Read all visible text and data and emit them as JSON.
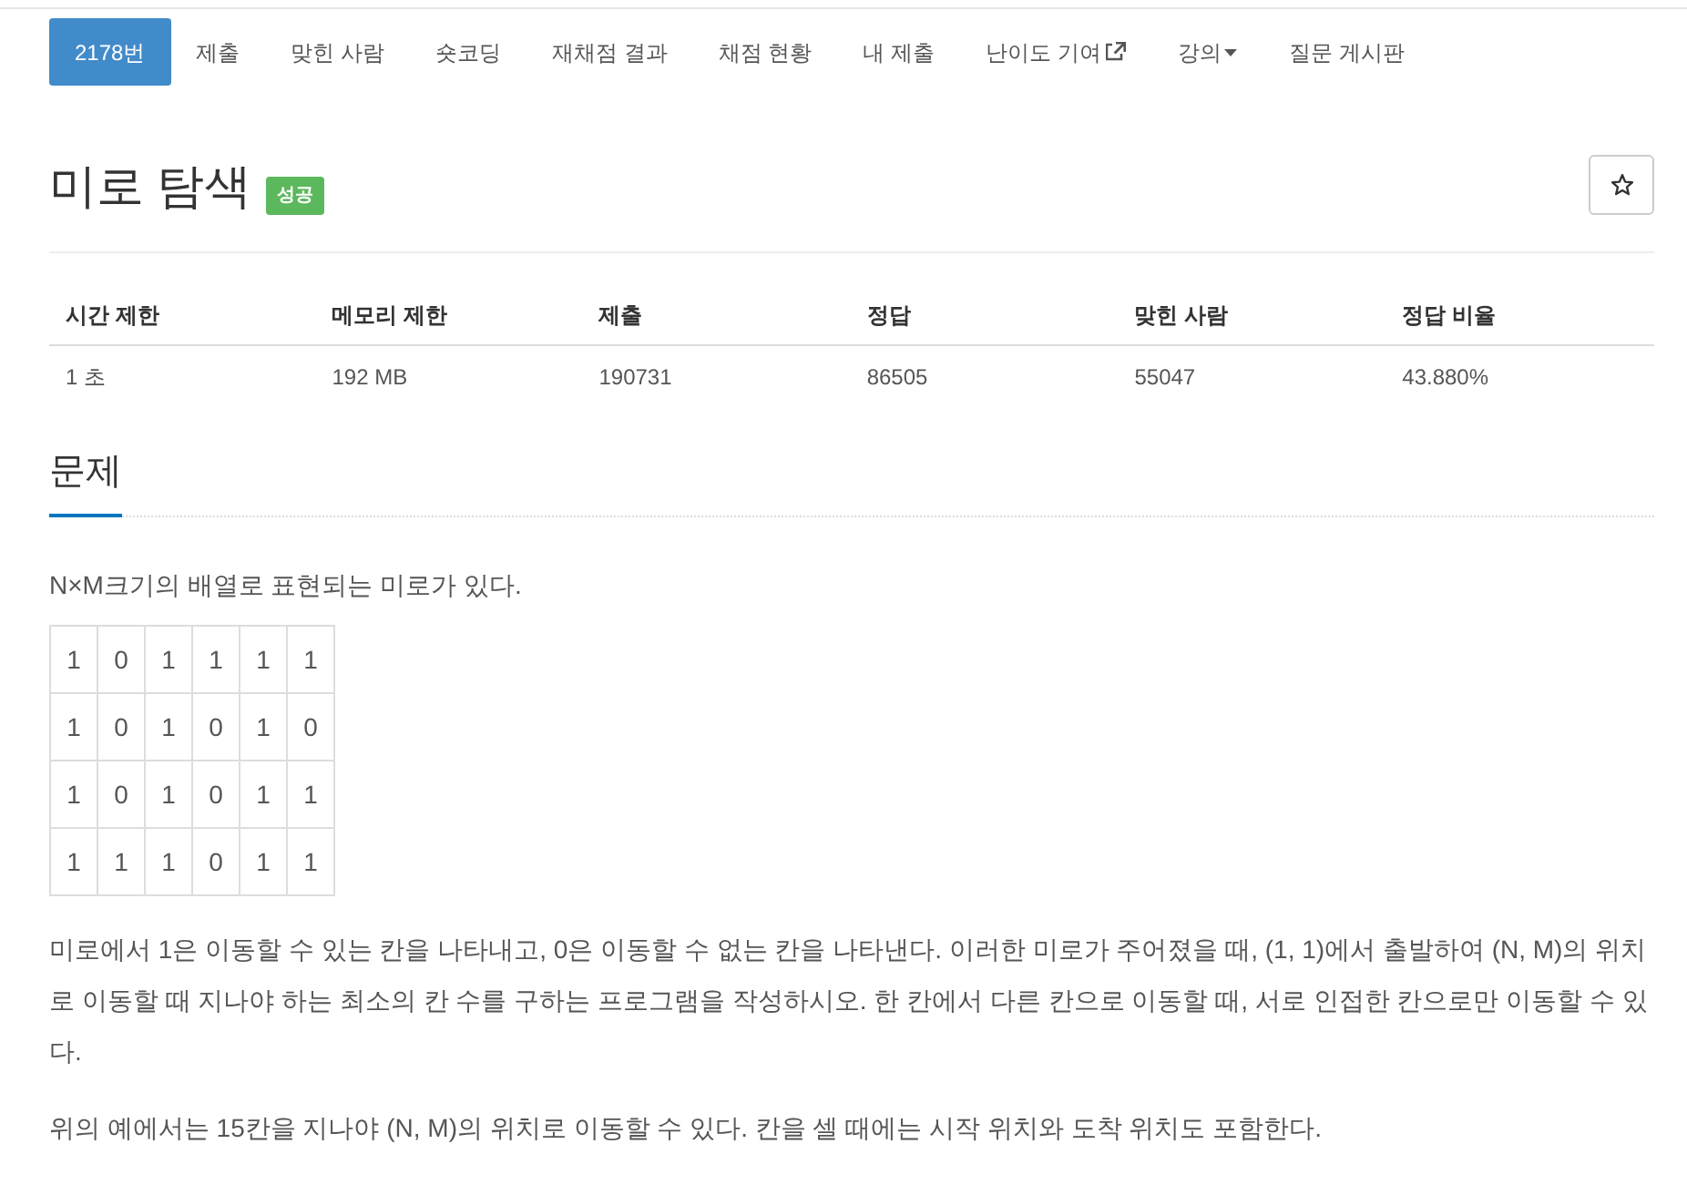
{
  "nav": {
    "tabs": [
      {
        "label": "2178번",
        "selected": true,
        "kind": "link"
      },
      {
        "label": "제출",
        "selected": false,
        "kind": "link"
      },
      {
        "label": "맞힌 사람",
        "selected": false,
        "kind": "link"
      },
      {
        "label": "숏코딩",
        "selected": false,
        "kind": "link"
      },
      {
        "label": "재채점 결과",
        "selected": false,
        "kind": "link"
      },
      {
        "label": "채점 현황",
        "selected": false,
        "kind": "link"
      },
      {
        "label": "내 제출",
        "selected": false,
        "kind": "link"
      },
      {
        "label": "난이도 기여",
        "selected": false,
        "kind": "external"
      },
      {
        "label": "강의",
        "selected": false,
        "kind": "dropdown"
      },
      {
        "label": "질문 게시판",
        "selected": false,
        "kind": "link"
      }
    ]
  },
  "problem": {
    "title": "미로 탐색",
    "badge": "성공"
  },
  "info_table": {
    "columns": [
      "시간 제한",
      "메모리 제한",
      "제출",
      "정답",
      "맞힌 사람",
      "정답 비율"
    ],
    "rows": [
      [
        "1 초",
        "192 MB",
        "190731",
        "86505",
        "55047",
        "43.880%"
      ]
    ]
  },
  "section": {
    "heading": "문제"
  },
  "description": {
    "intro": "N×M크기의 배열로 표현되는 미로가 있다.",
    "maze": [
      [
        "1",
        "0",
        "1",
        "1",
        "1",
        "1"
      ],
      [
        "1",
        "0",
        "1",
        "0",
        "1",
        "0"
      ],
      [
        "1",
        "0",
        "1",
        "0",
        "1",
        "1"
      ],
      [
        "1",
        "1",
        "1",
        "0",
        "1",
        "1"
      ]
    ],
    "paragraphs": [
      "미로에서 1은 이동할 수 있는 칸을 나타내고, 0은 이동할 수 없는 칸을 나타낸다. 이러한 미로가 주어졌을 때, (1, 1)에서 출발하여 (N, M)의 위치로 이동할 때 지나야 하는 최소의 칸 수를 구하는 프로그램을 작성하시오. 한 칸에서 다른 칸으로 이동할 때, 서로 인접한 칸으로만 이동할 수 있다.",
      "위의 예에서는 15칸을 지나야 (N, M)의 위치로 이동할 수 있다. 칸을 셀 때에는 시작 위치와 도착 위치도 포함한다."
    ]
  }
}
